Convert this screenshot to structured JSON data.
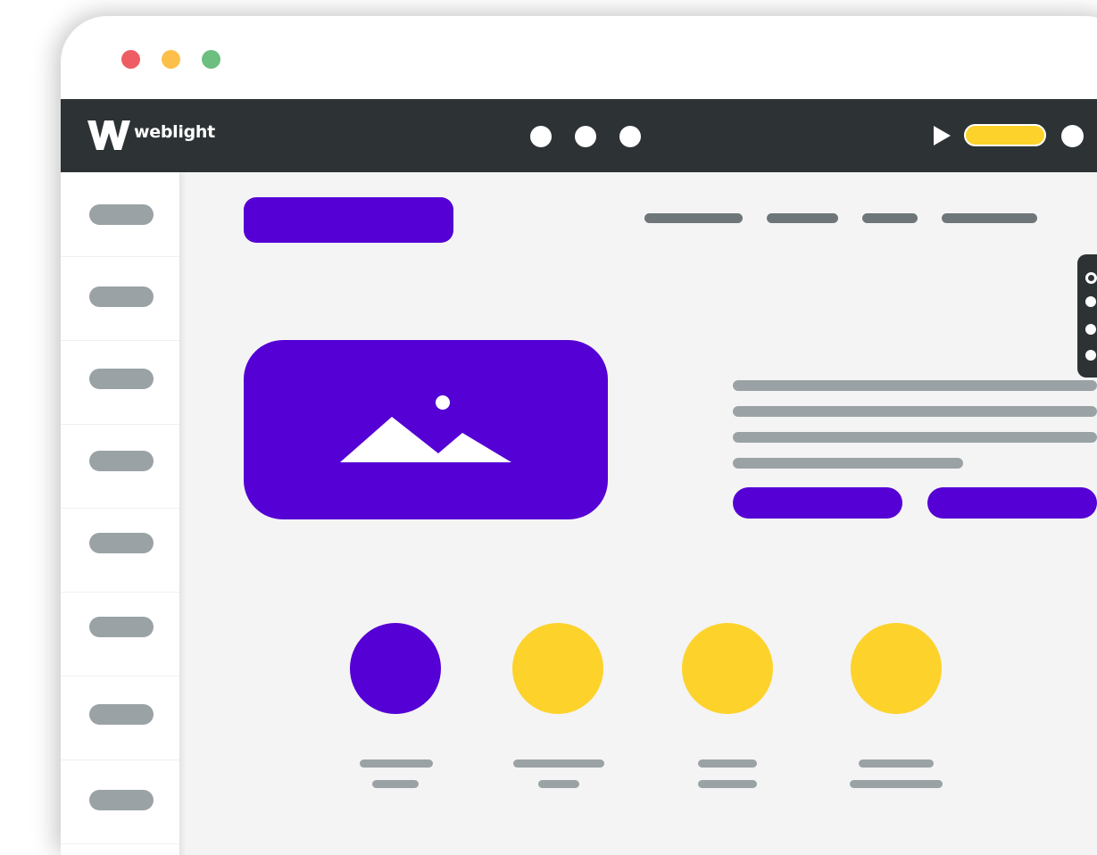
{
  "window_controls": [
    {
      "name": "close",
      "color": "#ee5d63"
    },
    {
      "name": "minimize",
      "color": "#fcc04a"
    },
    {
      "name": "maximize",
      "color": "#6cbf7e"
    }
  ],
  "header": {
    "logo_mark": "W",
    "logo_text": "weblight",
    "nav_dots": [
      "nav-dot",
      "nav-dot",
      "nav-dot"
    ],
    "play_icon": "play-icon",
    "pill_color": "#fdd22b"
  },
  "sidebar": {
    "items": [
      "placeholder",
      "placeholder",
      "placeholder",
      "placeholder",
      "placeholder",
      "placeholder",
      "placeholder",
      "placeholder"
    ]
  },
  "hero": {
    "image_icon": "mountain-image-icon",
    "buttons": [
      "primary-button",
      "secondary-button"
    ]
  },
  "features": [
    {
      "color": "#5500d4"
    },
    {
      "color": "#fdd22b"
    },
    {
      "color": "#fdd22b"
    },
    {
      "color": "#fdd22b"
    }
  ],
  "colors": {
    "accent": "#5500d4",
    "navbar": "#2d3335",
    "highlight": "#fdd22b",
    "placeholder": "#9aa2a5"
  }
}
